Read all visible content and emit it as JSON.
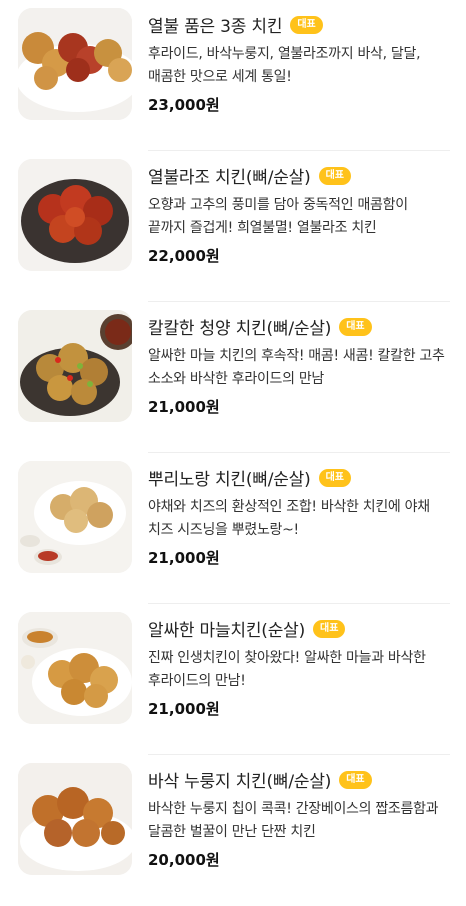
{
  "menu": {
    "badge_label": "대표",
    "items": [
      {
        "name": "열불 품은 3종 치킨",
        "desc": "후라이드, 바삭누룽지, 열불라조까지 바삭, 달달, 매콤한 맛으로 세계 통일!",
        "price": "23,000원"
      },
      {
        "name": "열불라조 치킨(뼈/순살)",
        "desc": "오향과 고추의 풍미를 담아 중독적인 매콤함이 끝까지 즐겁게! 희열불멸! 열불라조 치킨",
        "price": "22,000원"
      },
      {
        "name": "칼칼한 청양 치킨(뼈/순살)",
        "desc": "알싸한 마늘 치킨의 후속작! 매콤! 새콤! 칼칼한 고추 소소와 바삭한 후라이드의 만남",
        "price": "21,000원"
      },
      {
        "name": "뿌리노랑 치킨(뼈/순살)",
        "desc": "야채와 치즈의 환상적인 조합! 바삭한 치킨에 야채 치즈 시즈닝을 뿌렸노랑~!",
        "price": "21,000원"
      },
      {
        "name": "알싸한 마늘치킨(순살)",
        "desc": "진짜 인생치킨이 찾아왔다! 알싸한 마늘과 바삭한 후라이드의 만남!",
        "price": "21,000원"
      },
      {
        "name": "바삭 누룽지 치킨(뼈/순살)",
        "desc": "바삭한 누룽지 칩이 콕콕! 간장베이스의 짭조름함과 달콤한 벌꿀이 만난 단짠 치킨",
        "price": "20,000원"
      }
    ]
  }
}
